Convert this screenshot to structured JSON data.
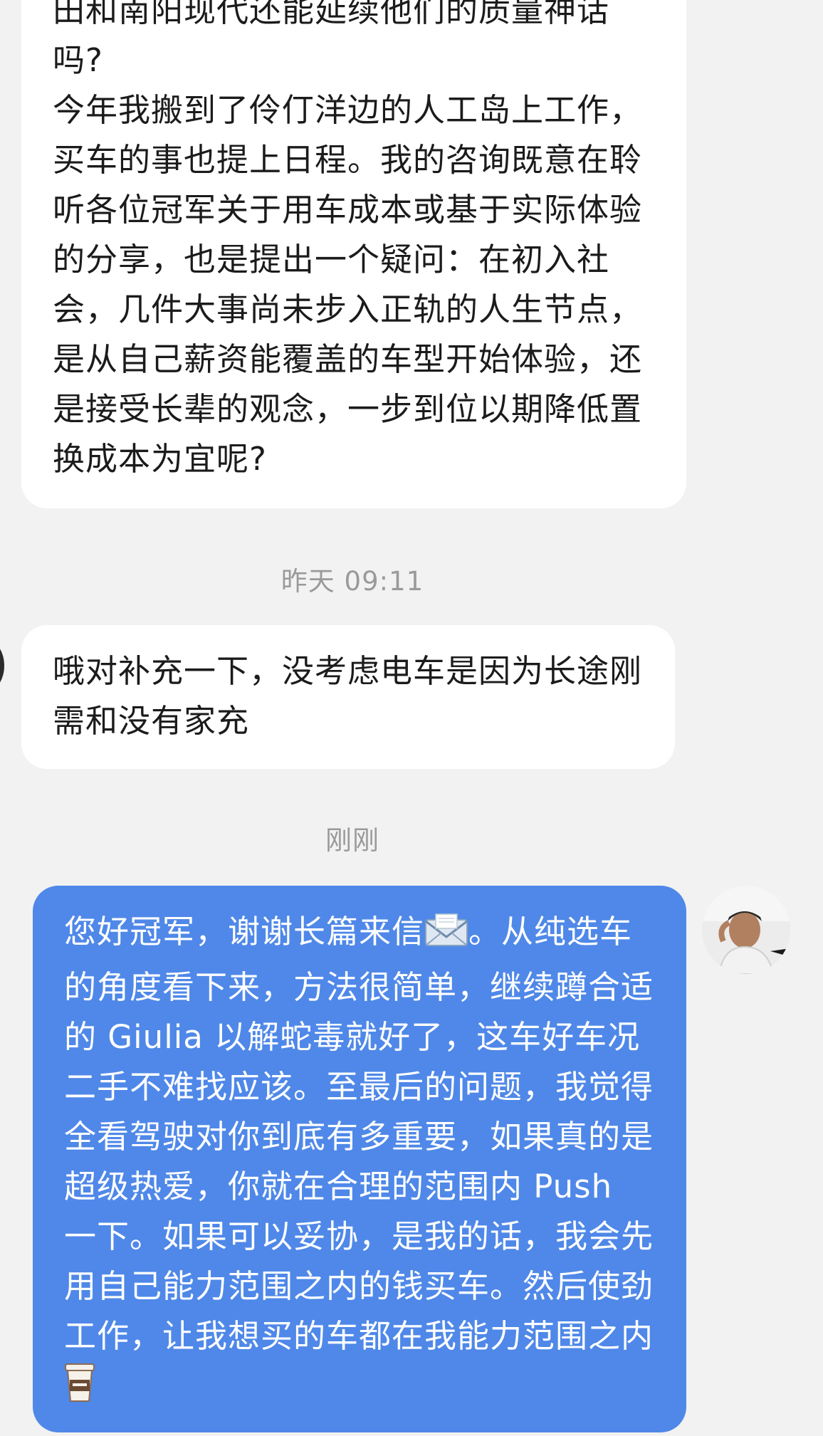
{
  "messages": [
    {
      "id": "msg-incoming-1",
      "sender": "other",
      "text": "田和南阳现代还能延续他们的质量神话吗?\n今年我搬到了伶仃洋边的人工岛上工作，买车的事也提上日程。我的咨询既意在聆听各位冠军关于用车成本或基于实际体验的分享，也是提出一个疑问：在初入社会，几件大事尚未步入正轨的人生节点，是从自己薪资能覆盖的车型开始体验，还是接受长辈的观念，一步到位以期降低置换成本为宜呢?"
    },
    {
      "id": "msg-incoming-2",
      "sender": "other",
      "timestamp": "昨天 09:11",
      "text": "哦对补充一下，没考虑电车是因为长途刚需和没有家充"
    },
    {
      "id": "msg-outgoing-1",
      "sender": "me",
      "timestamp": "刚刚",
      "text_before_emoji": "您好冠军，谢谢长篇来信",
      "emoji_1": "envelope-icon",
      "text_middle": "。从纯选车的角度看下来，方法很简单，继续蹲合适的 Giulia 以解蛇毒就好了，这车好车况二手不难找应该。至最后的问题，我觉得全看驾驶对你到底有多重要，如果真的是超级热爱，你就在合理的范围内 Push 一下。如果可以妥协，是我的话，我会先用自己能力范围之内的钱买车。然后使劲工作，让我想买的车都在我能力范围之内",
      "emoji_2": "coffee-cup-icon"
    }
  ],
  "colors": {
    "background": "#f2f2f2",
    "incoming_bubble": "#ffffff",
    "outgoing_bubble": "#4f88e8",
    "timestamp_text": "#9a9a9a"
  }
}
